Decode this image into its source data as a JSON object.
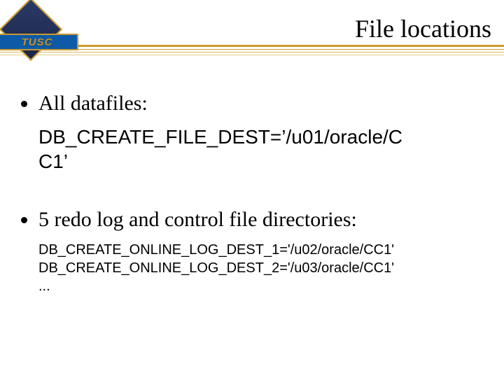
{
  "logo": {
    "text": "TUSC"
  },
  "title": "File locations",
  "bullet1": {
    "lead": "All datafiles:",
    "code_l1": "DB_CREATE_FILE_DEST=’/u01/oracle/C",
    "code_l2": "C1’"
  },
  "bullet2": {
    "lead": "5 redo log and control file directories:",
    "line1": "DB_CREATE_ONLINE_LOG_DEST_1='/u02/oracle/CC1'",
    "line2": "DB_CREATE_ONLINE_LOG_DEST_2='/u03/oracle/CC1'",
    "ellipsis": "..."
  }
}
